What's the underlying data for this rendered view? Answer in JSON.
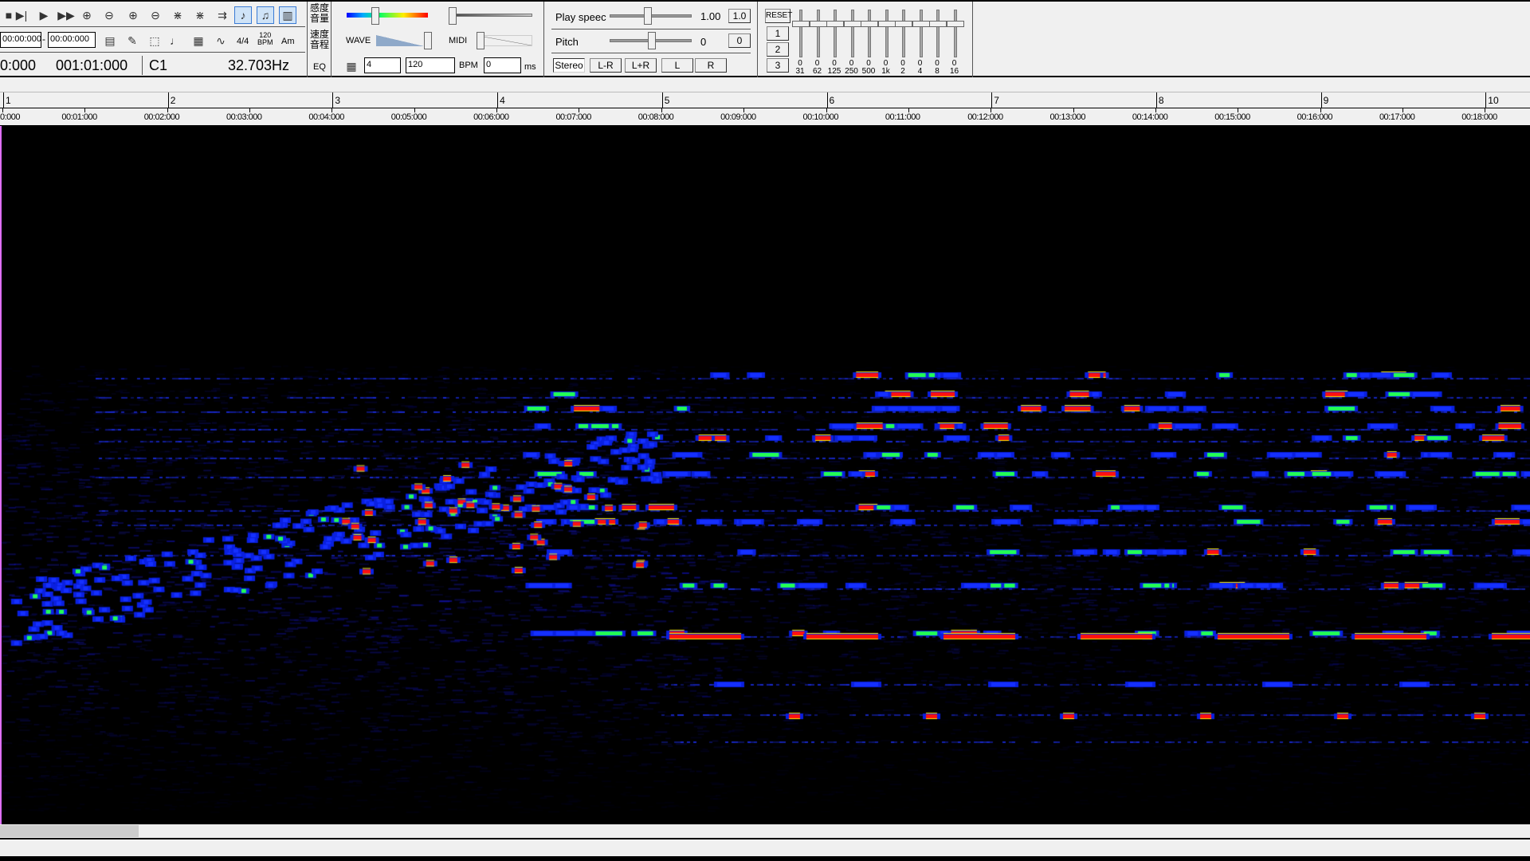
{
  "transport": {
    "icons": [
      "stop-icon",
      "play-from-cursor-icon",
      "play-icon",
      "fast-forward-icon",
      "zoom-in-horizontal-icon",
      "zoom-out-horizontal-icon",
      "zoom-in-vertical-icon",
      "zoom-out-vertical-icon",
      "expand-icon",
      "collapse-icon",
      "loop-icon",
      "wave-view-icon",
      "midi-view-icon",
      "score-view-icon"
    ]
  },
  "range": {
    "start": "00:00:000",
    "end": "00:00:000",
    "dash": "-"
  },
  "tools": {
    "meter": "4/4",
    "bpm_top": "120",
    "bpm_bottom": "BPM",
    "key": "Am"
  },
  "readout": {
    "time": "0:000",
    "position": "001:01:000",
    "note": "C1",
    "freq": "32.703Hz"
  },
  "side_labels": {
    "sensitivity": "感度\n音量",
    "speed": "速度\n音程",
    "eq": "EQ"
  },
  "display": {
    "wave_label": "WAVE",
    "midi_label": "MIDI",
    "beats_value": "4",
    "tempo_value": "120",
    "bpm_label": "BPM",
    "offset_value": "0",
    "ms_label": "ms"
  },
  "playback": {
    "speed_label": "Play speec",
    "speed_value": "1.00",
    "speed_reset": "1.0",
    "pitch_label": "Pitch",
    "pitch_value": "0",
    "pitch_reset": "0",
    "channels": [
      "Stereo",
      "L-R",
      "L+R",
      "L",
      "R"
    ],
    "selected_channel": "Stereo"
  },
  "eq": {
    "reset": "RESET",
    "presets": [
      "1",
      "2",
      "3"
    ],
    "bands": [
      {
        "v": "0",
        "f": "31"
      },
      {
        "v": "0",
        "f": "62"
      },
      {
        "v": "0",
        "f": "125"
      },
      {
        "v": "0",
        "f": "250"
      },
      {
        "v": "0",
        "f": "500"
      },
      {
        "v": "0",
        "f": "1k"
      },
      {
        "v": "0",
        "f": "2"
      },
      {
        "v": "0",
        "f": "4"
      },
      {
        "v": "0",
        "f": "8"
      },
      {
        "v": "0",
        "f": "16"
      }
    ]
  },
  "ruler": {
    "measures": [
      "1",
      "2",
      "3",
      "4",
      "5",
      "6",
      "7",
      "8",
      "9",
      "10"
    ],
    "times": [
      "0:000",
      "00:01:000",
      "00:02:000",
      "00:03:000",
      "00:04:000",
      "00:05:000",
      "00:06:000",
      "00:07:000",
      "00:08:000",
      "00:09:000",
      "00:10:000",
      "00:11:000",
      "00:12:000",
      "00:13:000",
      "00:14:000",
      "00:15:000",
      "00:16:000",
      "00:17:000",
      "00:18:000"
    ]
  },
  "colors": {
    "spectrum_low": "#0000ff",
    "spectrum_mid": "#00ff66",
    "spectrum_high": "#ff0000",
    "cursor": "#e070ff"
  }
}
